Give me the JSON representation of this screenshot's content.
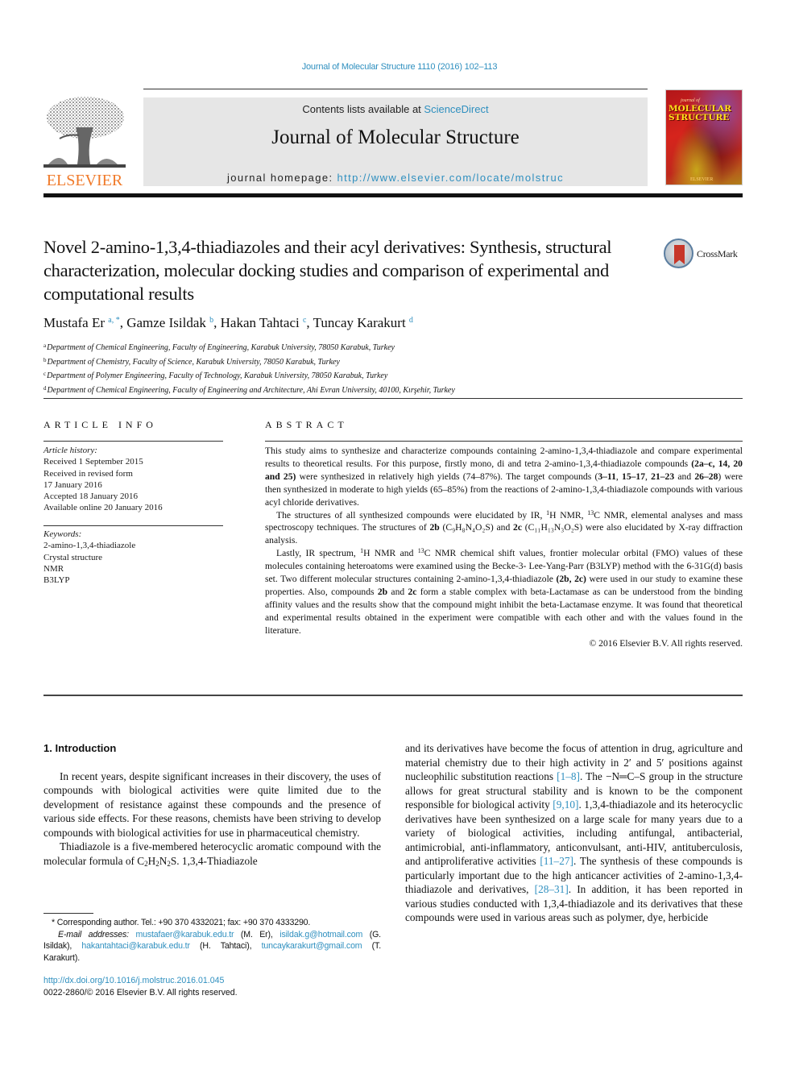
{
  "citation": "Journal of Molecular Structure 1110 (2016) 102–113",
  "header": {
    "publisher_logo_text": "ELSEVIER",
    "contents_prefix": "Contents lists available at ",
    "contents_link": "ScienceDirect",
    "journal_title": "Journal of Molecular Structure",
    "homepage_prefix": "journal homepage: ",
    "homepage_url": "http://www.elsevier.com/locate/molstruc",
    "cover": {
      "series_small": "journal of",
      "title_line1": "MOLECULAR",
      "title_line2": "STRUCTURE",
      "publisher": "ELSEVIER"
    }
  },
  "article": {
    "title": "Novel 2-amino-1,3,4-thiadiazoles and their acyl derivatives: Synthesis, structural characterization, molecular docking studies and comparison of experimental and computational results",
    "crossmark_label": "CrossMark",
    "authors": [
      {
        "name": "Mustafa Er",
        "sup": "a, *"
      },
      {
        "name": "Gamze Isildak",
        "sup": "b"
      },
      {
        "name": "Hakan Tahtaci",
        "sup": "c"
      },
      {
        "name": "Tuncay Karakurt",
        "sup": "d"
      }
    ],
    "affiliations": [
      {
        "key": "a",
        "text": "Department of Chemical Engineering, Faculty of Engineering, Karabuk University, 78050 Karabuk, Turkey"
      },
      {
        "key": "b",
        "text": "Department of Chemistry, Faculty of Science, Karabuk University, 78050 Karabuk, Turkey"
      },
      {
        "key": "c",
        "text": "Department of Polymer Engineering, Faculty of Technology, Karabuk University, 78050 Karabuk, Turkey"
      },
      {
        "key": "d",
        "text": "Department of Chemical Engineering, Faculty of Engineering and Architecture, Ahi Evran University, 40100, Kırşehir, Turkey"
      }
    ]
  },
  "article_info": {
    "heading": "ARTICLE INFO",
    "history_label": "Article history:",
    "history": [
      "Received 1 September 2015",
      "Received in revised form",
      "17 January 2016",
      "Accepted 18 January 2016",
      "Available online 20 January 2016"
    ],
    "keywords_label": "Keywords:",
    "keywords": [
      "2-amino-1,3,4-thiadiazole",
      "Crystal structure",
      "NMR",
      "B3LYP"
    ]
  },
  "abstract": {
    "heading": "ABSTRACT",
    "p1": {
      "t1": "This study aims to synthesize and characterize compounds containing 2-amino-1,3,4-thiadiazole and compare experimental results to theoretical results. For this purpose, firstly mono, di and tetra 2-amino-1,3,4-thiadiazole compounds ",
      "b1": "(2a–c, 14, 20 and 25)",
      "t2": " were synthesized in relatively high yields (74–87%). The target compounds (",
      "b2": "3–11",
      "t3": ", ",
      "b3": "15–17",
      "t4": ", ",
      "b4": "21–23",
      "t5": " and ",
      "b5": "26–28",
      "t6": ") were then synthesized in moderate to high yields (65–85%) from the reactions of 2-amino-1,3,4-thiadiazole compounds with various acyl chloride derivatives."
    },
    "p2": {
      "t1": "The structures of all synthesized compounds were elucidated by IR, ",
      "sup1": "1",
      "t2": "H NMR, ",
      "sup2": "13",
      "t3": "C NMR, elemental analyses and mass spectroscopy techniques. The structures of ",
      "b1": "2b",
      "f1": "(C₉H₈N₄O₂S)",
      "t4": " and ",
      "b2": "2c",
      "f2": "(C₁₁H₁₃N₃O₂S)",
      "t5": " were also elucidated by X-ray diffraction analysis."
    },
    "p3": {
      "t1": "Lastly, IR spectrum, ",
      "sup1": "1",
      "t2": "H NMR and ",
      "sup2": "13",
      "t3": "C NMR chemical shift values, frontier molecular orbital (FMO) values of these molecules containing heteroatoms were examined using the Becke-3- Lee-Yang-Parr (B3LYP) method with the 6-31G(d) basis set. Two different molecular structures containing 2-amino-1,3,4-thiadiazole ",
      "b1": "(2b, 2c)",
      "t4": " were used in our study to examine these properties. Also, compounds ",
      "b2": "2b",
      "t5": " and ",
      "b3": "2c",
      "t6": " form a stable complex with beta-Lactamase as can be understood from the binding affinity values and the results show that the compound might inhibit the beta-Lactamase enzyme. It was found that theoretical and experimental results obtained in the experiment were compatible with each other and with the values found in the literature."
    },
    "copyright": "© 2016 Elsevier B.V. All rights reserved."
  },
  "introduction": {
    "heading": "1.  Introduction",
    "p1": "In recent years, despite significant increases in their discovery, the uses of compounds with biological activities were quite limited due to the development of resistance against these compounds and the presence of various side effects. For these reasons, chemists have been striving to develop compounds with biological activities for use in pharmaceutical chemistry.",
    "p2_start": "Thiadiazole is a five-membered heterocyclic aromatic compound with the molecular formula of C",
    "p2_formula_sub1": "2",
    "p2_formula_mid1": "H",
    "p2_formula_sub2": "2",
    "p2_formula_mid2": "N",
    "p2_formula_sub3": "2",
    "p2_end": "S. 1,3,4-Thiadiazole",
    "right": {
      "t1": "and its derivatives have become the focus of attention in drug, agriculture and material chemistry due to their high activity in 2′ and 5′ positions against nucleophilic substitution reactions ",
      "ref1": "[1–8]",
      "t2": ". The −N═C–S group in the structure allows for great structural stability and is known to be the component responsible for biological activity ",
      "ref2": "[9,10]",
      "t3": ". 1,3,4-thiadiazole and its heterocyclic derivatives have been synthesized on a large scale for many years due to a variety of biological activities, including antifungal, antibacterial, antimicrobial, anti-inflammatory, anticonvulsant, anti-HIV, antituberculosis, and antiproliferative activities ",
      "ref3": "[11–27]",
      "t4": ". The synthesis of these compounds is particularly important due to the high anticancer activities of 2-amino-1,3,4-thiadiazole and derivatives, ",
      "ref4": "[28–31]",
      "t5": ". In addition, it has been reported in various studies conducted with 1,3,4-thiadiazole and its derivatives that these compounds were used in various areas such as polymer, dye, herbicide"
    }
  },
  "footnotes": {
    "corresponding": "* Corresponding author. Tel.: +90 370 4332021; fax: +90 370 4333290.",
    "email_label": "E-mail addresses:",
    "emails": [
      {
        "addr": "mustafaer@karabuk.edu.tr",
        "who": " (M. Er), "
      },
      {
        "addr": "isildak.g@hotmail.com",
        "who": " (G. Isildak), "
      },
      {
        "addr": "hakantahtaci@karabuk.edu.tr",
        "who": " (H. Tahtaci), "
      },
      {
        "addr": "tuncaykarakurt@gmail.com",
        "who": " (T. Karakurt)."
      }
    ],
    "doi": "http://dx.doi.org/10.1016/j.molstruc.2016.01.045",
    "issn": "0022-2860/© 2016 Elsevier B.V. All rights reserved."
  },
  "colors": {
    "link": "#2e8fbf",
    "elsevier_orange": "#f07a2a",
    "header_band": "#e6e6e6"
  }
}
